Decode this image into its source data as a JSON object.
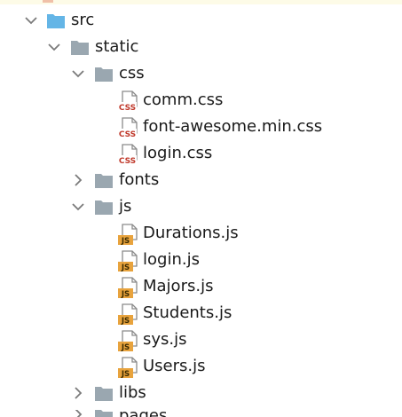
{
  "colors": {
    "folder_blue": "#64b5e6",
    "folder_gray": "#9aa7b0",
    "css_badge": "#c0392b",
    "js_badge": "#e8a33d",
    "arrow": "#7a7a7a"
  },
  "tree": {
    "src": {
      "label": "src",
      "icon": "folder-blue-icon"
    },
    "static": {
      "label": "static",
      "icon": "folder-icon"
    },
    "css": {
      "label": "css",
      "icon": "folder-icon"
    },
    "css_files": [
      {
        "label": "comm.css",
        "badge": "CSS"
      },
      {
        "label": "font-awesome.min.css",
        "badge": "CSS"
      },
      {
        "label": "login.css",
        "badge": "CSS"
      }
    ],
    "fonts": {
      "label": "fonts",
      "icon": "folder-icon"
    },
    "js": {
      "label": "js",
      "icon": "folder-icon"
    },
    "js_files": [
      {
        "label": "Durations.js",
        "badge": "JS"
      },
      {
        "label": "login.js",
        "badge": "JS"
      },
      {
        "label": "Majors.js",
        "badge": "JS"
      },
      {
        "label": "Students.js",
        "badge": "JS"
      },
      {
        "label": "sys.js",
        "badge": "JS"
      },
      {
        "label": "Users.js",
        "badge": "JS"
      }
    ],
    "libs": {
      "label": "libs",
      "icon": "folder-icon"
    },
    "pages": {
      "label": "pages",
      "icon": "folder-icon"
    }
  }
}
